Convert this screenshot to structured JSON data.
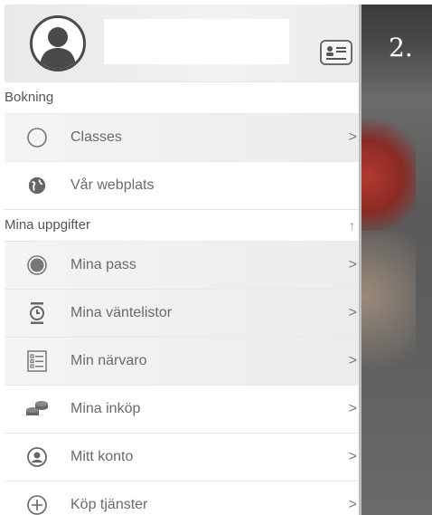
{
  "header": {
    "step_number": "2."
  },
  "sections": [
    {
      "title": "Bokning",
      "items": [
        {
          "label": "Classes",
          "icon": "circle-outline-icon",
          "chevron": ">"
        },
        {
          "label": "Vår webplats",
          "icon": "globe-icon",
          "chevron": ""
        }
      ]
    },
    {
      "title": "Mina uppgifter",
      "collapse_arrow": "↑",
      "items": [
        {
          "label": "Mina pass",
          "icon": "filled-circle-icon",
          "chevron": ">"
        },
        {
          "label": "Mina väntelistor",
          "icon": "timer-icon",
          "chevron": ">"
        },
        {
          "label": "Min närvaro",
          "icon": "checklist-icon",
          "chevron": ">"
        },
        {
          "label": "Mina inköp",
          "icon": "coins-icon",
          "chevron": ">"
        },
        {
          "label": "Mitt konto",
          "icon": "account-icon",
          "chevron": ">"
        },
        {
          "label": "Köp tjänster",
          "icon": "add-circle-icon",
          "chevron": ">"
        }
      ]
    }
  ]
}
